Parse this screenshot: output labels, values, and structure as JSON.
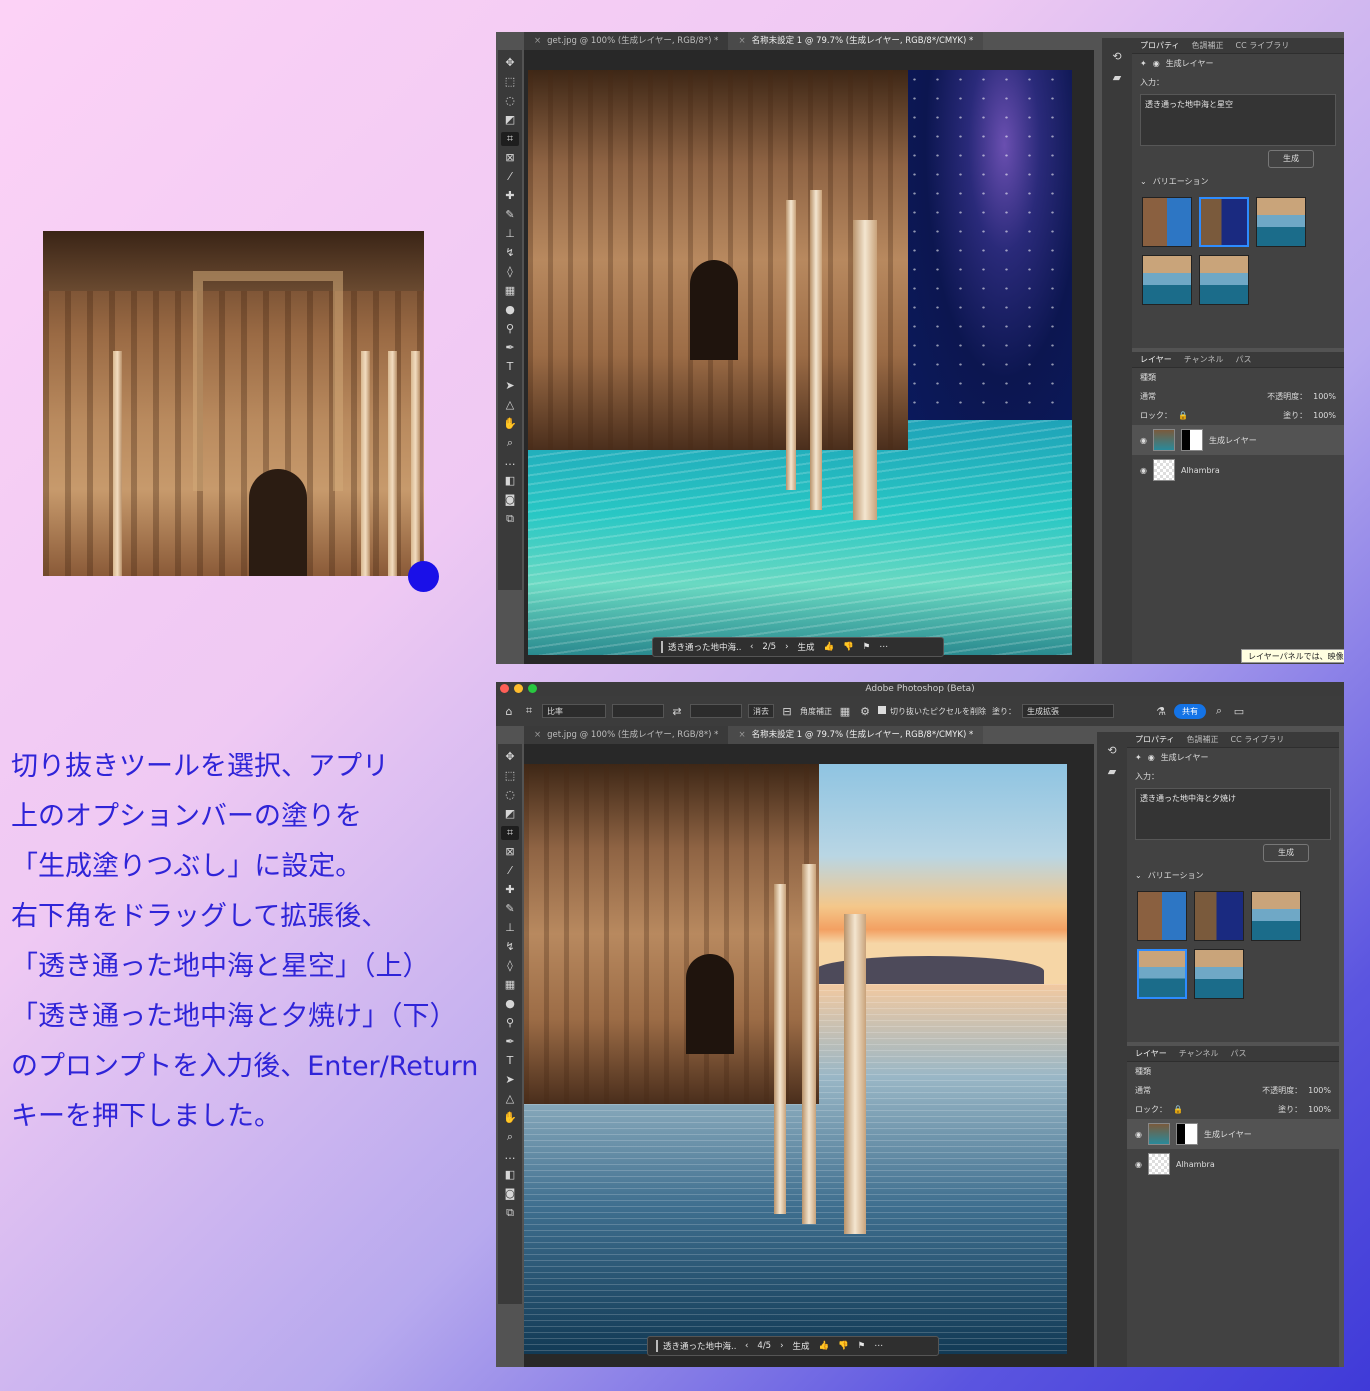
{
  "instructions": [
    "切り抜きツールを選択、アプリ",
    "上のオプションバーの塗りを",
    "「生成塗りつぶし」に設定。",
    "右下角をドラッグして拡張後、",
    "「透き通った地中海と星空」（上）",
    "「透き通った地中海と夕焼け」（下）",
    "のプロンプトを入力後、Enter/Return",
    "キーを押下しました。"
  ],
  "colors": {
    "instruction_text": "#2f24d8",
    "dot": "#1a10e8",
    "accent": "#1473e6"
  },
  "top_window": {
    "tabs": [
      {
        "label": "get.jpg @ 100% (生成レイヤー, RGB/8*) *",
        "active": false
      },
      {
        "label": "名称未設定 1 @ 79.7% (生成レイヤー, RGB/8*/CMYK) *",
        "active": true
      }
    ],
    "context_bar": {
      "prompt": "透き通った地中海...",
      "counter": "2/5",
      "generate": "生成"
    },
    "properties": {
      "tabs": [
        "プロパティ",
        "色調補正",
        "CC ライブラリ"
      ],
      "layer_type": "生成レイヤー",
      "input_label": "入力：",
      "prompt": "透き通った地中海と星空",
      "generate": "生成",
      "variations_label": "バリエーション"
    },
    "layers": {
      "tabs": [
        "レイヤー",
        "チャンネル",
        "パス"
      ],
      "filter": "種類",
      "blend": "通常",
      "opacity_label": "不透明度：",
      "opacity": "100%",
      "lock_label": "ロック：",
      "fill_label": "塗り：",
      "fill": "100%",
      "items": [
        "生成レイヤー",
        "Alhambra"
      ]
    },
    "tooltip": "レイヤーパネルでは、映像"
  },
  "bottom_window": {
    "title": "Adobe Photoshop (Beta)",
    "options": {
      "ratio": "比率",
      "clear": "消去",
      "straighten": "角度補正",
      "delete_pixels": "切り抜いたピクセルを削除",
      "fill_label": "塗り：",
      "fill_value": "生成拡張",
      "share": "共有"
    },
    "tabs": [
      {
        "label": "get.jpg @ 100% (生成レイヤー, RGB/8*) *",
        "active": false
      },
      {
        "label": "名称未設定 1 @ 79.7% (生成レイヤー, RGB/8*/CMYK) *",
        "active": true
      }
    ],
    "context_bar": {
      "prompt": "透き通った地中海...",
      "counter": "4/5",
      "generate": "生成"
    },
    "properties": {
      "tabs": [
        "プロパティ",
        "色調補正",
        "CC ライブラリ"
      ],
      "layer_type": "生成レイヤー",
      "input_label": "入力：",
      "prompt": "透き通った地中海と夕焼け",
      "generate": "生成",
      "variations_label": "バリエーション"
    },
    "layers": {
      "tabs": [
        "レイヤー",
        "チャンネル",
        "パス"
      ],
      "filter": "種類",
      "blend": "通常",
      "opacity_label": "不透明度：",
      "opacity": "100%",
      "lock_label": "ロック：",
      "fill_label": "塗り：",
      "fill": "100%",
      "items": [
        "生成レイヤー",
        "Alhambra"
      ]
    }
  }
}
